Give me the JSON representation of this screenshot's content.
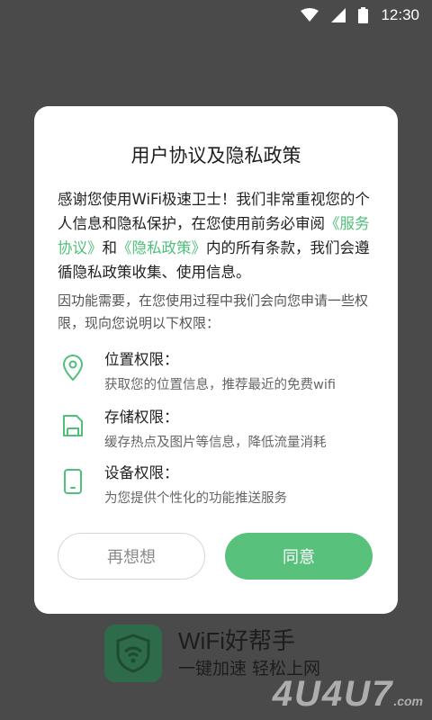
{
  "status_bar": {
    "time": "12:30",
    "icons": [
      "wifi-icon",
      "signal-icon",
      "battery-icon"
    ]
  },
  "background": {
    "app_name": "WiFi好帮手",
    "slogan": "一键加速 轻松上网",
    "watermark": "4U4U7",
    "watermark_suffix": ".com"
  },
  "dialog": {
    "title": "用户协议及隐私政策",
    "intro": {
      "part1": "感谢您使用WiFi极速卫士！我们非常重视您的个人信息和隐私保护，在您使用前务必审阅",
      "link1": "《服务协议》",
      "and": "和",
      "link2": "《隐私政策》",
      "part2": "内的所有条款，我们会遵循隐私政策收集、使用信息。"
    },
    "subintro": "因功能需要，在您使用过程中我们会向您申请一些权限，现向您说明以下权限：",
    "permissions": [
      {
        "icon": "location-pin-icon",
        "title": "位置权限：",
        "desc": "获取您的位置信息，推荐最近的免费wifi"
      },
      {
        "icon": "storage-icon",
        "title": "存储权限：",
        "desc": "缓存热点及图片等信息，降低流量消耗"
      },
      {
        "icon": "device-icon",
        "title": "设备权限：",
        "desc": "为您提供个性化的功能推送服务"
      }
    ],
    "buttons": {
      "reject": "再想想",
      "agree": "同意"
    }
  },
  "colors": {
    "accent": "#58c27d",
    "link": "#4fbf7a",
    "overlay": "#4a4a4a"
  }
}
